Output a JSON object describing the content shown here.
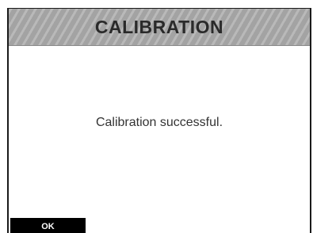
{
  "dialog": {
    "title": "CALIBRATION",
    "message": "Calibration successful.",
    "ok_label": "OK"
  },
  "colors": {
    "title_bar": "#a9a9a9",
    "title_text": "#2a2a2a",
    "button_background": "#000000",
    "button_text": "#ffffff"
  }
}
